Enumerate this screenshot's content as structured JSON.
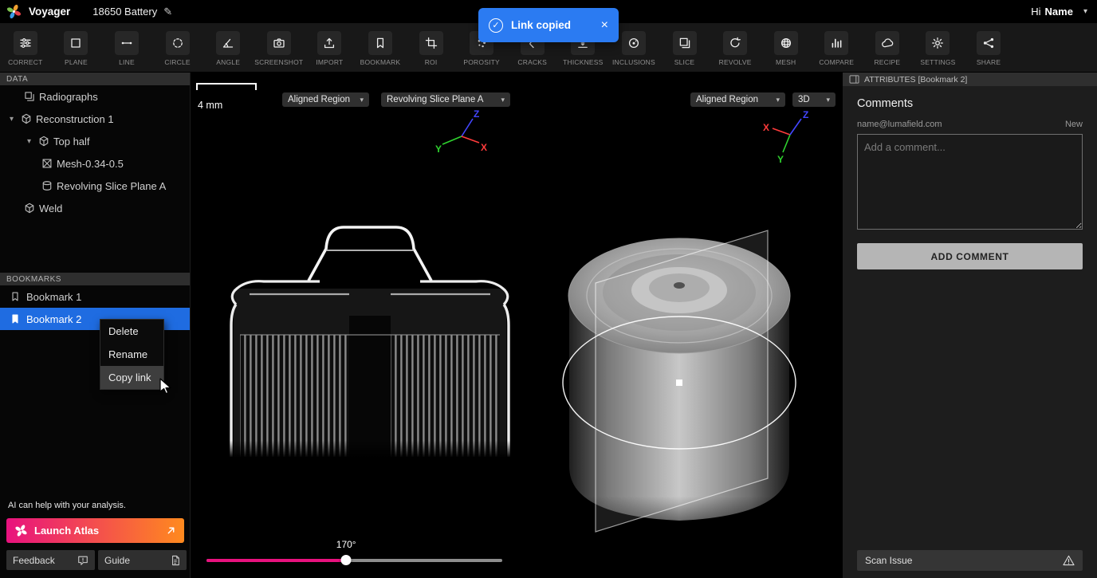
{
  "titlebar": {
    "app_name": "Voyager",
    "project_title": "18650 Battery",
    "greeting": "Hi",
    "user_name": "Name"
  },
  "toast": {
    "message": "Link copied"
  },
  "toolbar": {
    "items": [
      {
        "label": "CORRECT",
        "icon": "correct-sliders-icon"
      },
      {
        "label": "PLANE",
        "icon": "plane-icon"
      },
      {
        "label": "LINE",
        "icon": "line-icon"
      },
      {
        "label": "CIRCLE",
        "icon": "circle-icon"
      },
      {
        "label": "ANGLE",
        "icon": "angle-icon"
      },
      {
        "label": "SCREENSHOT",
        "icon": "camera-icon"
      },
      {
        "label": "IMPORT",
        "icon": "import-icon"
      },
      {
        "label": "BOOKMARK",
        "icon": "bookmark-icon"
      },
      {
        "label": "ROI",
        "icon": "roi-crop-icon"
      },
      {
        "label": "POROSITY",
        "icon": "porosity-icon"
      },
      {
        "label": "CRACKS",
        "icon": "cracks-icon"
      },
      {
        "label": "THICKNESS",
        "icon": "thickness-icon"
      },
      {
        "label": "INCLUSIONS",
        "icon": "inclusions-icon"
      },
      {
        "label": "SLICE",
        "icon": "slice-icon"
      },
      {
        "label": "REVOLVE",
        "icon": "revolve-icon"
      },
      {
        "label": "MESH",
        "icon": "mesh-icon"
      },
      {
        "label": "COMPARE",
        "icon": "compare-icon"
      },
      {
        "label": "RECIPE",
        "icon": "recipe-icon"
      },
      {
        "label": "SETTINGS",
        "icon": "settings-icon"
      },
      {
        "label": "SHARE",
        "icon": "share-icon"
      }
    ]
  },
  "sidebar": {
    "data_header": "DATA",
    "tree": [
      {
        "label": "Radiographs",
        "icon": "radiographs-layers-icon",
        "level": 1
      },
      {
        "label": "Reconstruction 1",
        "icon": "cube-icon",
        "level": 0,
        "expanded": true
      },
      {
        "label": "Top half",
        "icon": "cube-icon",
        "level": 1,
        "expanded": true
      },
      {
        "label": "Mesh-0.34-0.5",
        "icon": "mesh-grid-icon",
        "level": 2
      },
      {
        "label": "Revolving Slice Plane A",
        "icon": "cylinder-icon",
        "level": 2
      },
      {
        "label": "Weld",
        "icon": "cube-icon",
        "level": 1
      }
    ],
    "bookmarks_header": "BOOKMARKS",
    "bookmarks": [
      {
        "label": "Bookmark 1",
        "selected": false
      },
      {
        "label": "Bookmark 2",
        "selected": true
      }
    ],
    "ai_hint": "AI can help with your analysis.",
    "launch_atlas_label": "Launch Atlas",
    "feedback_label": "Feedback",
    "guide_label": "Guide"
  },
  "context_menu": {
    "items": [
      {
        "label": "Delete"
      },
      {
        "label": "Rename"
      },
      {
        "label": "Copy link"
      }
    ],
    "highlighted": "Copy link"
  },
  "viewport": {
    "scale_label": "4 mm",
    "left_view": {
      "region_select": "Aligned Region",
      "slice_select": "Revolving Slice Plane A"
    },
    "right_view": {
      "region_select": "Aligned Region",
      "mode_select": "3D"
    },
    "rotation_slider": {
      "label": "170°",
      "min": 0,
      "max": 360,
      "value": 170
    },
    "axes": {
      "x": "X",
      "y": "Y",
      "z": "Z"
    }
  },
  "attributes_panel": {
    "header": "ATTRIBUTES [Bookmark 2]",
    "comments_title": "Comments",
    "author_email": "name@lumafield.com",
    "new_label": "New",
    "comment_placeholder": "Add a comment...",
    "add_comment_label": "ADD COMMENT",
    "scan_issue_label": "Scan Issue"
  },
  "icons": {
    "chevron_down": "▾",
    "pencil": "✎",
    "close": "×",
    "check": "✓"
  },
  "colors": {
    "toast_blue": "#2b7bf2",
    "selection_blue": "#1f6ce1",
    "slider_pink": "#e8127e",
    "atlas_gradient_start": "#e8127e",
    "atlas_gradient_end": "#ff8a1e",
    "axis_x": "#ff3b3b",
    "axis_y": "#2fd32f",
    "axis_z": "#4346ff"
  }
}
